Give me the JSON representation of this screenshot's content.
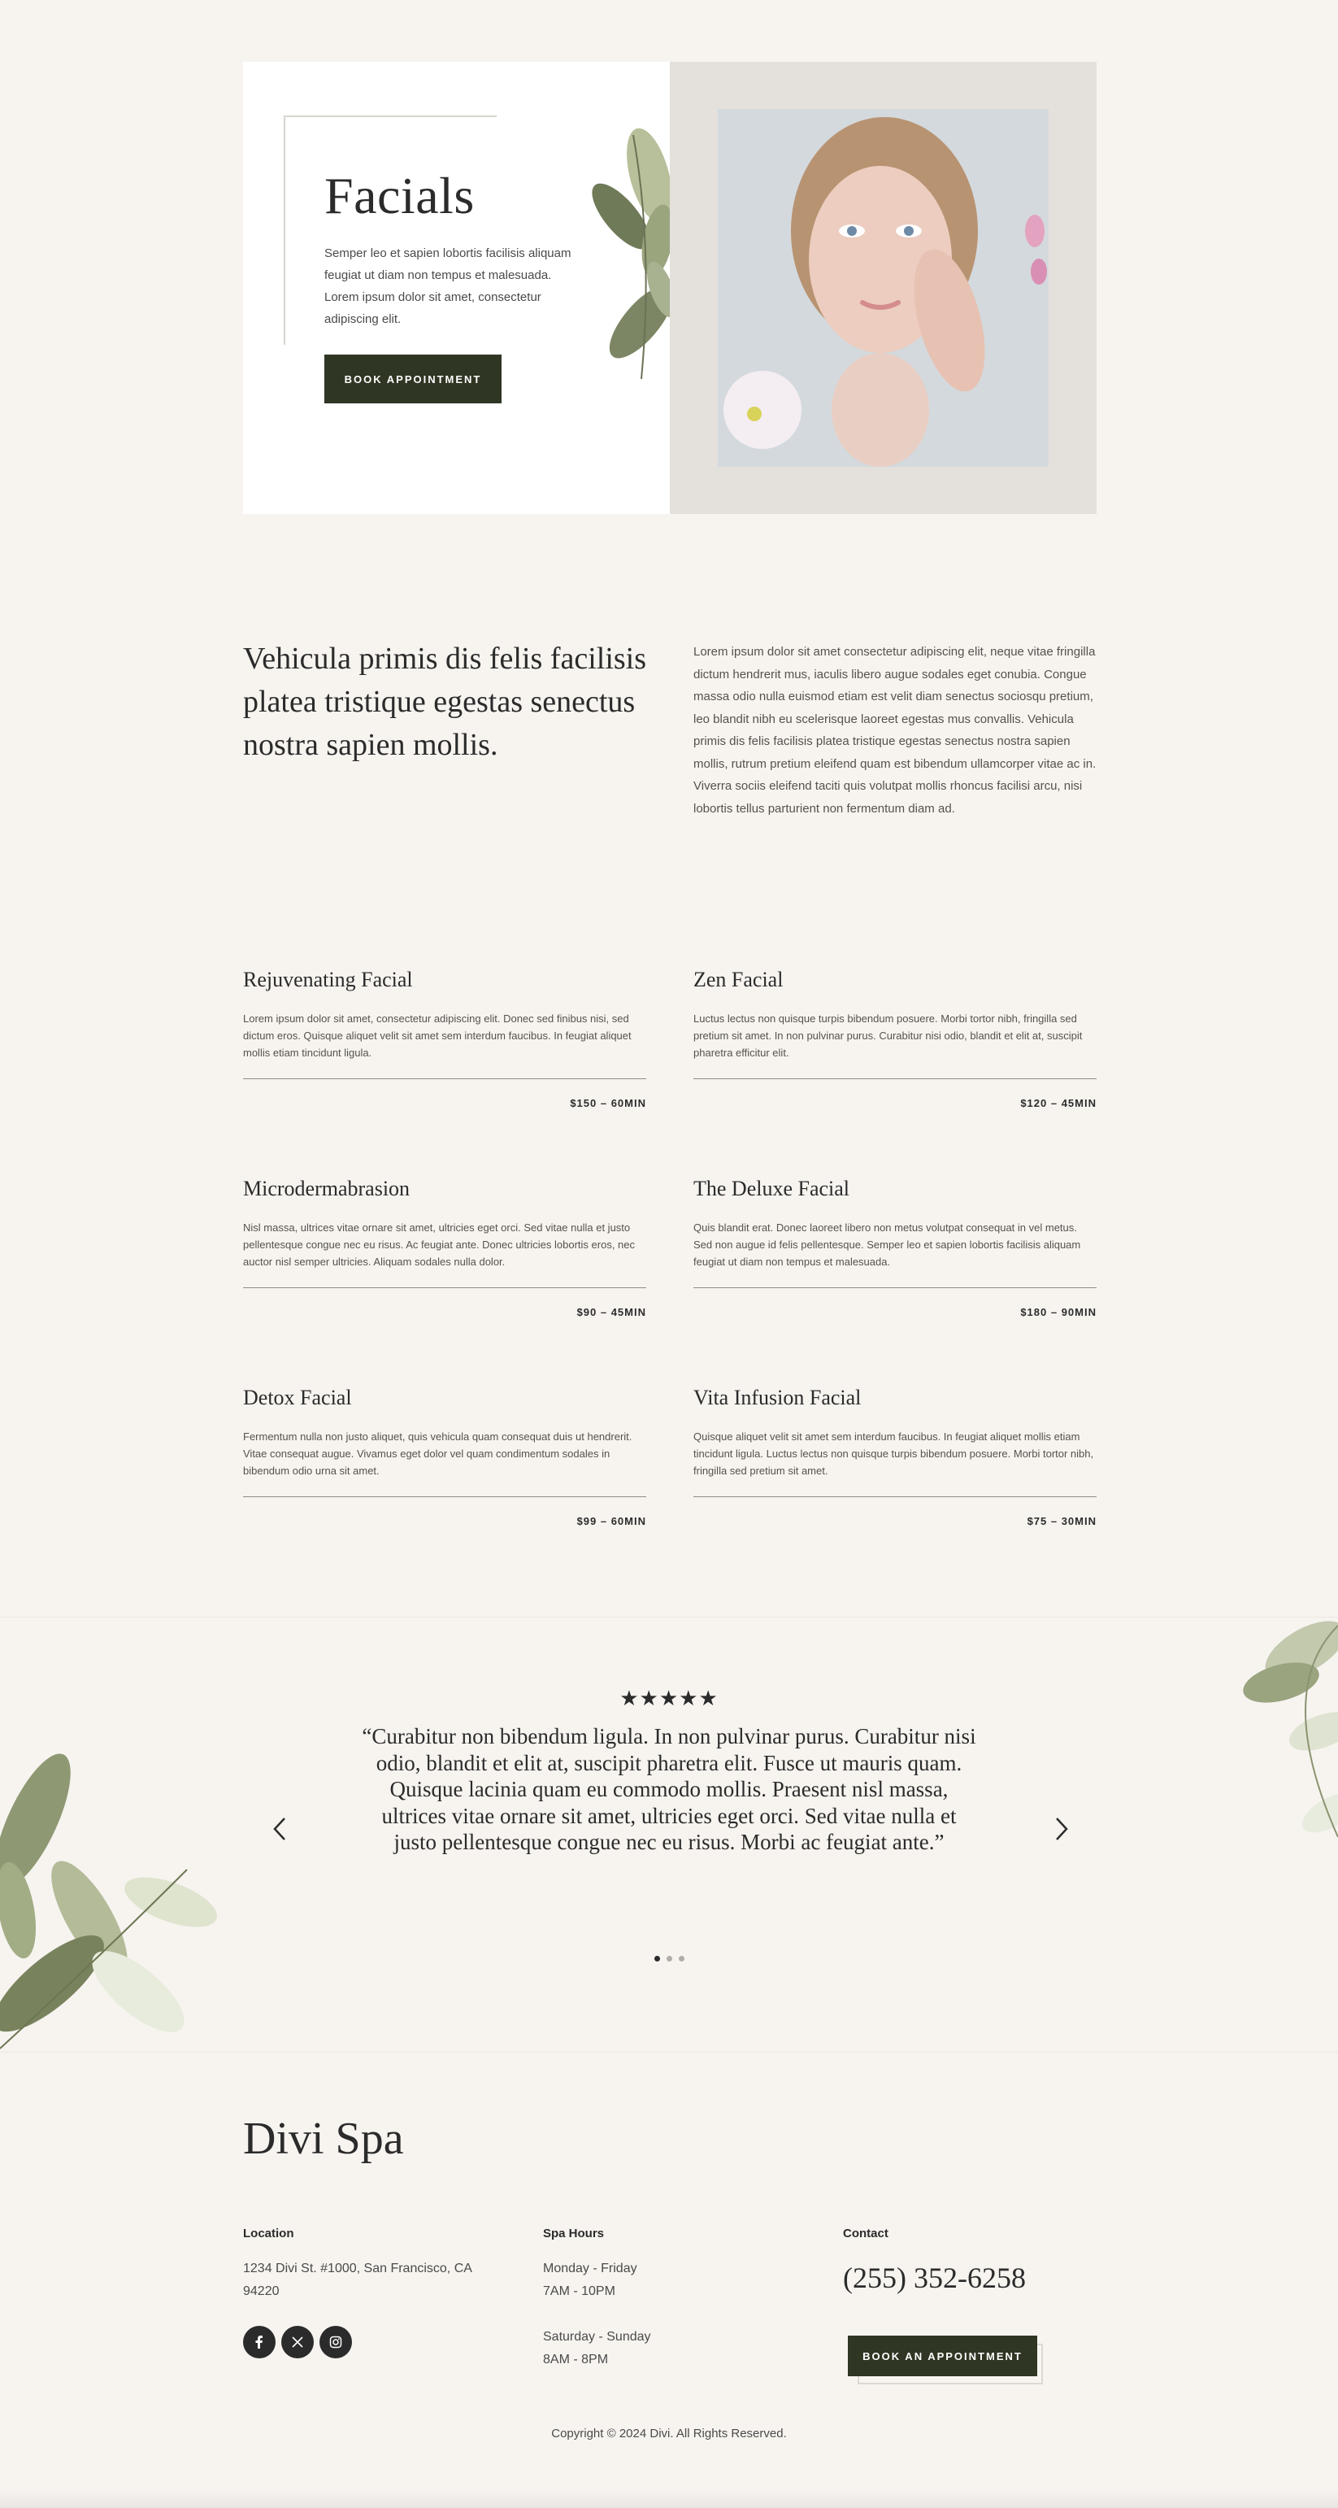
{
  "hero": {
    "title": "Facials",
    "description": "Semper leo et sapien lobortis facilisis aliquam feugiat ut diam non tempus et malesuada. Lorem ipsum dolor sit amet, consectetur adipiscing elit.",
    "button_label": "BOOK APPOINTMENT"
  },
  "intro": {
    "heading": "Vehicula primis dis felis facilisis platea tristique egestas senectus nostra sapien mollis.",
    "body": "Lorem ipsum dolor sit amet consectetur adipiscing elit, neque vitae fringilla dictum hendrerit mus, iaculis libero augue sodales eget conubia. Congue massa odio nulla euismod etiam est velit diam senectus sociosqu pretium, leo blandit nibh eu scelerisque laoreet egestas mus convallis. Vehicula primis dis felis facilisis platea tristique egestas senectus nostra sapien mollis, rutrum pretium eleifend quam est bibendum ullamcorper vitae ac in. Viverra sociis eleifend taciti quis volutpat mollis rhoncus facilisi arcu, nisi lobortis tellus parturient non fermentum diam ad."
  },
  "services": [
    {
      "name": "Rejuvenating Facial",
      "description": "Lorem ipsum dolor sit amet, consectetur adipiscing elit. Donec sed finibus nisi, sed dictum eros. Quisque aliquet velit sit amet sem interdum faucibus. In feugiat aliquet mollis etiam tincidunt ligula.",
      "price": "$150 – 60MIN"
    },
    {
      "name": "Zen Facial",
      "description": "Luctus lectus non quisque turpis bibendum posuere. Morbi tortor nibh, fringilla sed pretium sit amet. In non pulvinar purus. Curabitur nisi odio, blandit et elit at, suscipit pharetra efficitur elit.",
      "price": "$120 – 45MIN"
    },
    {
      "name": "Microdermabrasion",
      "description": "Nisl massa, ultrices vitae ornare sit amet, ultricies eget orci. Sed vitae nulla et justo pellentesque congue nec eu risus. Ac feugiat ante. Donec ultricies lobortis eros, nec auctor nisl semper ultricies. Aliquam sodales nulla dolor.",
      "price": "$90 – 45MIN"
    },
    {
      "name": "The Deluxe Facial",
      "description": "Quis blandit erat. Donec laoreet libero non metus volutpat consequat in vel metus. Sed non augue id felis pellentesque. Semper leo et sapien lobortis facilisis aliquam feugiat ut diam non tempus et malesuada.",
      "price": "$180 – 90MIN"
    },
    {
      "name": "Detox Facial",
      "description": "Fermentum nulla non justo aliquet, quis vehicula quam consequat duis ut hendrerit. Vitae consequat augue. Vivamus eget dolor vel quam condimentum sodales in bibendum odio urna sit amet.",
      "price": "$99 – 60MIN"
    },
    {
      "name": "Vita Infusion Facial",
      "description": "Quisque aliquet velit sit amet sem interdum faucibus. In feugiat aliquet mollis etiam tincidunt ligula. Luctus lectus non quisque turpis bibendum posuere. Morbi tortor nibh, fringilla sed pretium sit amet.",
      "price": "$75 – 30MIN"
    }
  ],
  "testimonial": {
    "stars": "★★★★★",
    "quote": "“Curabitur non bibendum ligula. In non pulvinar purus. Curabitur nisi odio, blandit et elit at, suscipit pharetra elit. Fusce ut mauris quam. Quisque lacinia quam eu commodo mollis. Praesent nisl massa, ultrices vitae ornare sit amet, ultricies eget orci. Sed vitae nulla et justo pellentesque congue nec eu risus. Morbi ac feugiat ante.”",
    "active_slide": 1,
    "slide_count": 3
  },
  "footer": {
    "brand": "Divi Spa",
    "location_heading": "Location",
    "address": "1234 Divi St. #1000, San Francisco, CA 94220",
    "hours_heading": "Spa Hours",
    "weekday_days": "Monday - Friday",
    "weekday_hours": "7AM - 10PM",
    "weekend_days": "Saturday - Sunday",
    "weekend_hours": "8AM - 8PM",
    "contact_heading": "Contact",
    "phone": "(255) 352-6258",
    "button_label": "BOOK AN APPOINTMENT",
    "social": [
      "facebook-icon",
      "x-icon",
      "instagram-icon"
    ],
    "copyright": "Copyright © 2024 Divi. All Rights Reserved."
  },
  "colors": {
    "background": "#f7f4f0",
    "button": "#2f3623",
    "text": "#2b2b2b"
  }
}
